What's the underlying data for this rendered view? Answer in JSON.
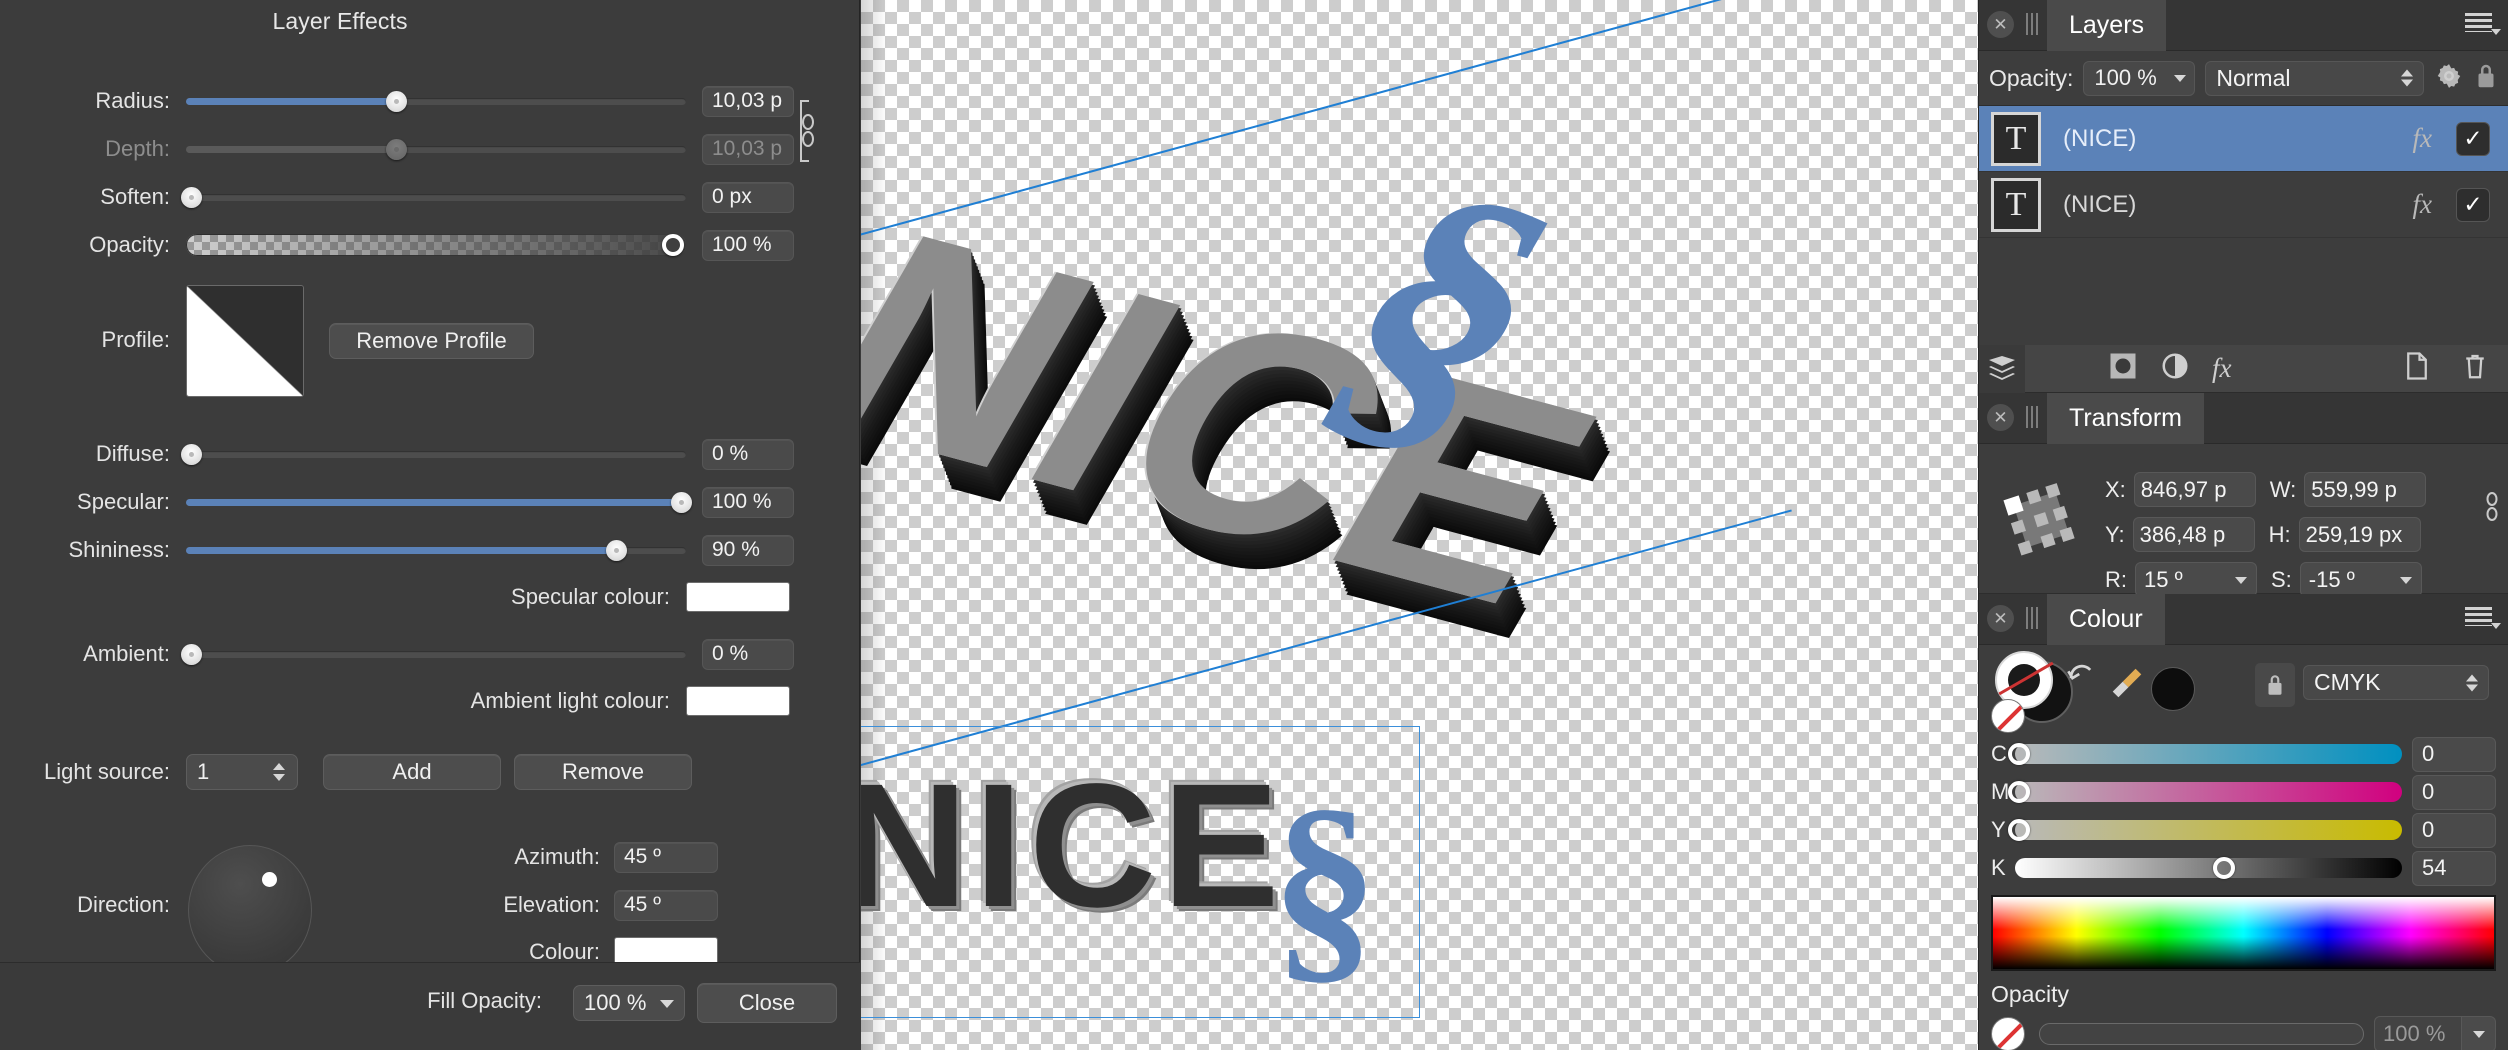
{
  "dialog": {
    "title": "Layer Effects",
    "rows": [
      {
        "label": "Radius:",
        "value": "10,03 p",
        "dim": false,
        "fill": 42
      },
      {
        "label": "Depth:",
        "value": "10,03 p",
        "dim": true,
        "fill": 42
      },
      {
        "label": "Soften:",
        "value": "0 px",
        "dim": false,
        "fill": 0
      },
      {
        "label": "Opacity:",
        "value": "100 %",
        "dim": false,
        "fill": 100
      }
    ],
    "profile_label": "Profile:",
    "remove_profile_label": "Remove Profile",
    "light_rows": [
      {
        "label": "Diffuse:",
        "value": "0 %",
        "fill": 0
      },
      {
        "label": "Specular:",
        "value": "100 %",
        "fill": 100
      },
      {
        "label": "Shininess:",
        "value": "90 %",
        "fill": 90
      }
    ],
    "specular_colour_label": "Specular colour:",
    "specular_colour": "#ffffff",
    "ambient_label": "Ambient:",
    "ambient_value": "0 %",
    "ambient_light_colour_label": "Ambient light colour:",
    "ambient_light_colour": "#ffffff",
    "light_source_label": "Light source:",
    "light_source_value": "1",
    "add_label": "Add",
    "remove_label": "Remove",
    "direction_label": "Direction:",
    "azimuth_label": "Azimuth:",
    "azimuth_value": "45 º",
    "elevation_label": "Elevation:",
    "elevation_value": "45 º",
    "colour_label": "Colour:",
    "colour_value": "#ffffff",
    "fill_opacity_label": "Fill Opacity:",
    "fill_opacity_value": "100 %",
    "close_label": "Close"
  },
  "canvas": {
    "top_text": "NICE",
    "top_section_sign": "§",
    "bottom_text": "NICE",
    "bottom_section_sign": "§"
  },
  "layers_panel": {
    "tab": "Layers",
    "opacity_label": "Opacity:",
    "opacity_value": "100 %",
    "blend_mode": "Normal",
    "gear_icon": "gear-icon",
    "lock_icon": "lock-icon",
    "items": [
      {
        "thumb": "T",
        "name": "(NICE)",
        "fx": "fx",
        "checked": "✓",
        "selected": true
      },
      {
        "thumb": "T",
        "name": "(NICE)",
        "fx": "fx",
        "checked": "✓",
        "selected": false
      }
    ],
    "toolbar_icons": [
      "layers-stack-icon",
      "mask-icon",
      "adjustment-icon",
      "fx-icon",
      "new-layer-icon",
      "delete-layer-icon"
    ]
  },
  "transform_panel": {
    "tab": "Transform",
    "x_label": "X:",
    "x_value": "846,97 p",
    "y_label": "Y:",
    "y_value": "386,48 p",
    "w_label": "W:",
    "w_value": "559,99 p",
    "h_label": "H:",
    "h_value": "259,19 px",
    "r_label": "R:",
    "r_value": "15 º",
    "s_label": "S:",
    "s_value": "-15 º"
  },
  "colour_panel": {
    "tab": "Colour",
    "model": "CMYK",
    "lock_icon": "lock-icon",
    "swap_icon": "swap-colours-icon",
    "picker_icon": "eyedropper-icon",
    "channels": [
      {
        "letter": "C",
        "value": "0",
        "pos": 0
      },
      {
        "letter": "M",
        "value": "0",
        "pos": 0
      },
      {
        "letter": "Y",
        "value": "0",
        "pos": 0
      },
      {
        "letter": "K",
        "value": "54",
        "pos": 54
      }
    ],
    "opacity_label": "Opacity",
    "opacity_value": "100 %"
  },
  "colors": {
    "accent": "#5b82b8",
    "selection": "#1f7fd4",
    "panel_bg": "#3d3d3d",
    "dialog_bg": "#3c3c3c"
  }
}
